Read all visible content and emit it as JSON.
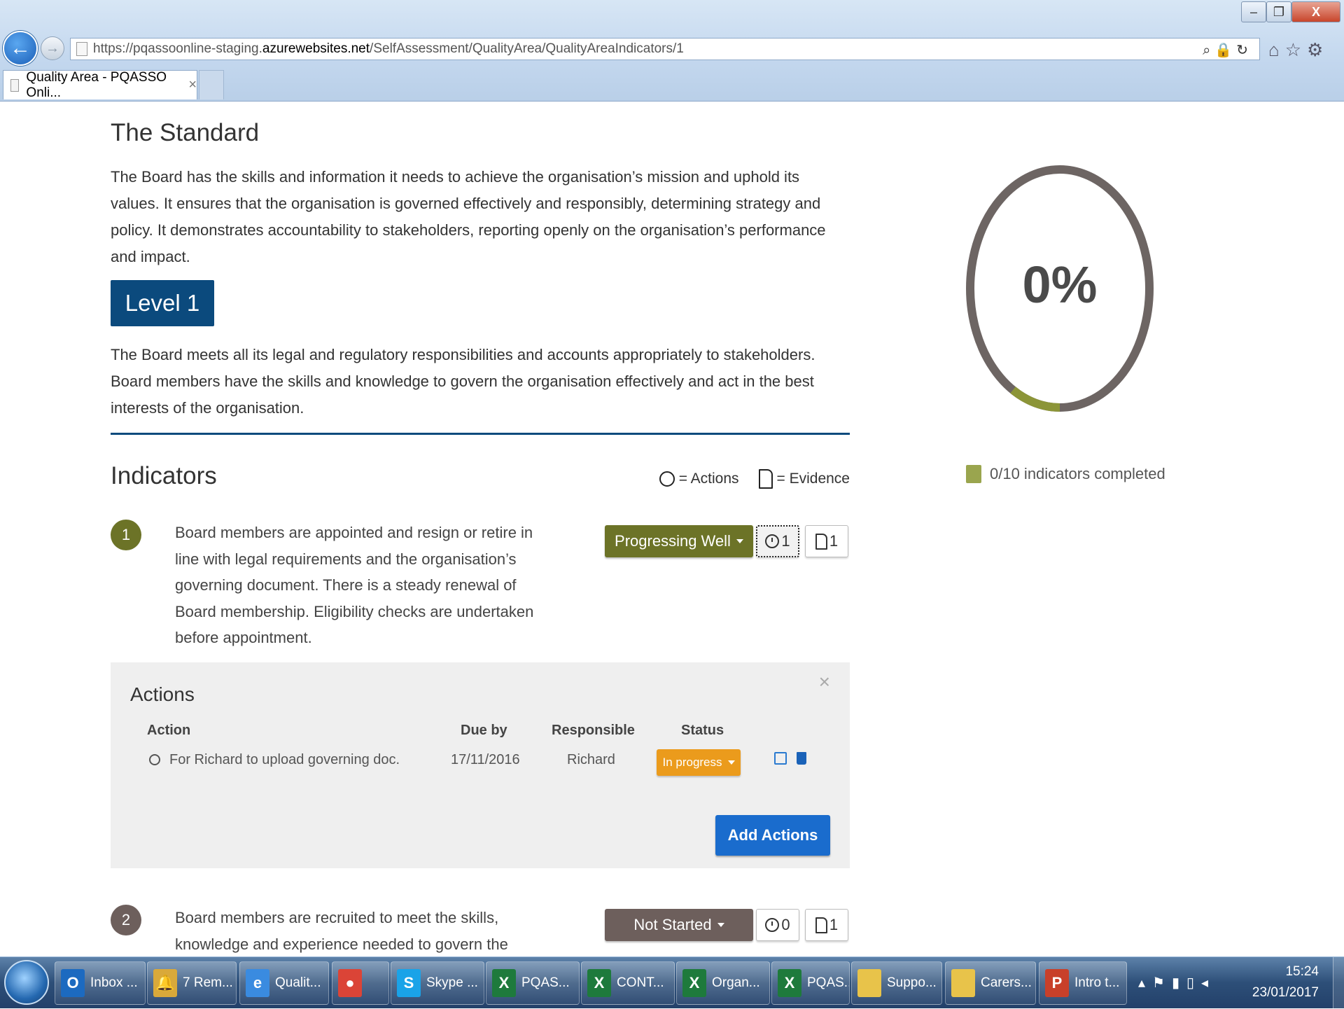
{
  "browser": {
    "url_prefix": "https://pqassoonline-staging.",
    "url_host": "azurewebsites.net",
    "url_path": "/SelfAssessment/QualityArea/QualityAreaIndicators/1",
    "tab_title": "Quality Area - PQASSO Onli...",
    "tab_close": "×"
  },
  "standard": {
    "heading": "The Standard",
    "text": "The Board has the skills and information it needs to achieve the organisation’s mission and uphold its values. It ensures that the organisation is governed effectively and responsibly, determining strategy and policy. It demonstrates accountability to stakeholders, reporting openly on the organisation’s performance and impact."
  },
  "level": {
    "label": "Level 1",
    "text": "The Board meets all its legal and regulatory responsibilities and accounts appropriately to stakeholders. Board members have the skills and knowledge to govern the organisation effectively and act in the best interests of the organisation."
  },
  "indicators": {
    "heading": "Indicators",
    "legend_actions": "= Actions",
    "legend_evidence": "= Evidence",
    "items": [
      {
        "number": "1",
        "text": "Board members are appointed and resign or retire in line with legal requirements and the organisation’s governing document. There is a steady renewal of Board membership. Eligibility checks are undertaken before appointment.",
        "status": "Progressing Well",
        "actions_count": "1",
        "evidence_count": "1",
        "color": "#6c7327"
      },
      {
        "number": "2",
        "text": "Board members are recruited to meet the skills, knowledge and experience needed to govern the",
        "status": "Not Started",
        "actions_count": "0",
        "evidence_count": "1",
        "color": "#6d5f5c"
      }
    ]
  },
  "actions_panel": {
    "title": "Actions",
    "close": "×",
    "columns": {
      "action": "Action",
      "due": "Due by",
      "responsible": "Responsible",
      "status": "Status"
    },
    "rows": [
      {
        "action": "For Richard to upload governing doc.",
        "due": "17/11/2016",
        "responsible": "Richard",
        "status": "In progress"
      }
    ],
    "add_label": "Add Actions"
  },
  "progress": {
    "percent_label": "0%",
    "completed_label": "0/10 indicators completed",
    "ring_color": "#6d6563",
    "arc_color": "#8c9538"
  },
  "taskbar": {
    "items": [
      {
        "label": "Inbox ...",
        "icon": "O",
        "color": "#1c6ac0"
      },
      {
        "label": "7 Rem...",
        "icon": "🔔",
        "color": "#d9a93a"
      },
      {
        "label": "Qualit...",
        "icon": "e",
        "color": "#3a8be0"
      },
      {
        "label": "",
        "icon": "●",
        "color": "#db4437"
      },
      {
        "label": "Skype ...",
        "icon": "S",
        "color": "#1aa3e8"
      },
      {
        "label": "PQAS...",
        "icon": "X",
        "color": "#1e7a3c"
      },
      {
        "label": "CONT...",
        "icon": "X",
        "color": "#1e7a3c"
      },
      {
        "label": "Organ...",
        "icon": "X",
        "color": "#1e7a3c"
      },
      {
        "label": "PQAS...",
        "icon": "X",
        "color": "#1e7a3c"
      },
      {
        "label": "Suppo...",
        "icon": "",
        "color": "#e8c34a"
      },
      {
        "label": "Carers...",
        "icon": "",
        "color": "#e8c34a"
      },
      {
        "label": "Intro t...",
        "icon": "P",
        "color": "#c8402a"
      }
    ],
    "time": "15:24",
    "date": "23/01/2017"
  }
}
